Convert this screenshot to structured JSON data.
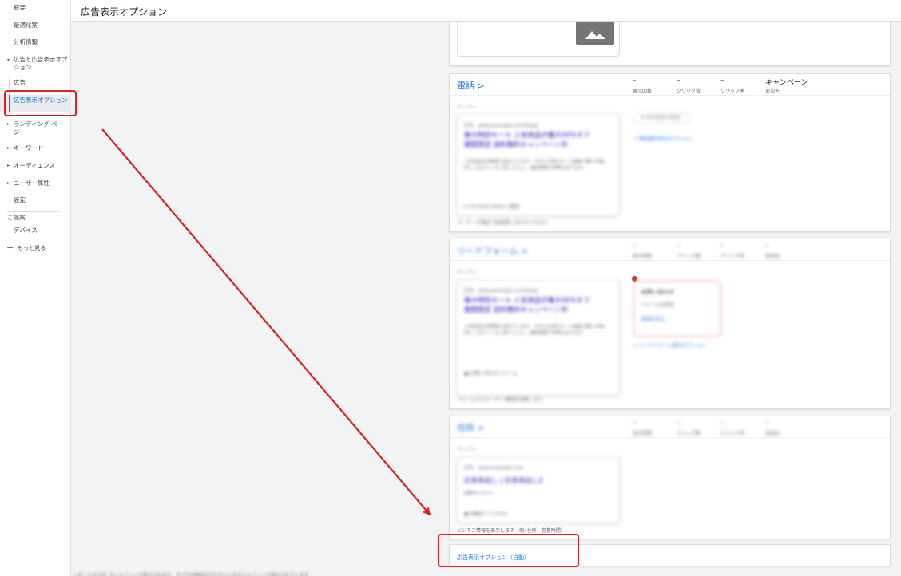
{
  "topbar": {
    "title": "広告表示オプション"
  },
  "sidebar": {
    "items": [
      {
        "label": "概要"
      },
      {
        "label": "最適化案"
      },
      {
        "label": "分析情報"
      },
      {
        "label": "広告と広告表示オプション"
      },
      {
        "label": "広告"
      },
      {
        "label": "広告表示オプション"
      },
      {
        "label": "ランディング ページ"
      },
      {
        "label": "キーワード"
      },
      {
        "label": "オーディエンス"
      },
      {
        "label": "ユーザー属性"
      },
      {
        "label": "設定"
      }
    ],
    "section_label": "ご提案",
    "extra_items": [
      {
        "label": "デバイス"
      }
    ],
    "more_label": "もっと見る"
  },
  "cards": {
    "phone": {
      "name": "電話 >",
      "metrics": [
        {
          "value": "–",
          "label": "表示回数"
        },
        {
          "value": "–",
          "label": "クリック数"
        },
        {
          "value": "–",
          "label": "クリック率"
        },
        {
          "value": "キャンペーン",
          "label": "追加先"
        }
      ]
    },
    "leadform": {
      "name": "リードフォーム >",
      "metrics": [
        {
          "value": "–",
          "label": "表示回数"
        },
        {
          "value": "–",
          "label": "クリック数"
        },
        {
          "value": "–",
          "label": "クリック率"
        },
        {
          "value": "–",
          "label": "追加先"
        }
      ]
    },
    "location": {
      "name": "住所 >",
      "metrics": [
        {
          "value": "–",
          "label": "表示回数"
        },
        {
          "value": "–",
          "label": "クリック数"
        },
        {
          "value": "–",
          "label": "クリック率"
        },
        {
          "value": "–",
          "label": "追加先"
        }
      ],
      "footnote": "ビジネス情報を表示します（例: 住所、営業時間）"
    },
    "auto": {
      "link": "広告表示オプション（自動）"
    }
  },
  "colors": {
    "accent": "#1a73e8",
    "annotation": "#e02020"
  }
}
